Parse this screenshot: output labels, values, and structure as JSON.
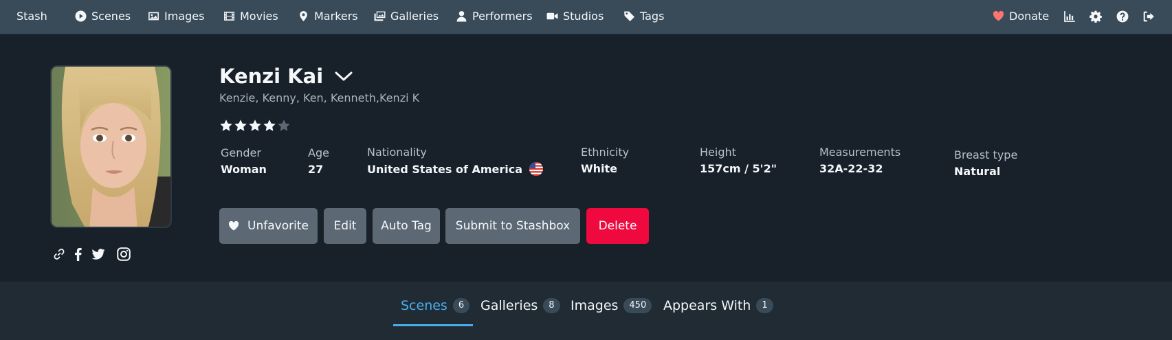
{
  "nav": {
    "brand": "Stash",
    "items": [
      {
        "label": "Scenes",
        "icon": "play-circle-icon"
      },
      {
        "label": "Images",
        "icon": "image-icon"
      },
      {
        "label": "Movies",
        "icon": "film-icon"
      },
      {
        "label": "Markers",
        "icon": "map-marker-icon"
      },
      {
        "label": "Galleries",
        "icon": "images-icon"
      },
      {
        "label": "Performers",
        "icon": "user-icon"
      },
      {
        "label": "Studios",
        "icon": "video-icon"
      },
      {
        "label": "Tags",
        "icon": "tag-icon"
      }
    ],
    "donate": "Donate",
    "right_icons": [
      "stats-icon",
      "gear-icon",
      "help-icon",
      "logout-icon"
    ]
  },
  "performer": {
    "name": "Kenzi Kai",
    "aliases": "Kenzie, Kenny, Ken, Kenneth,Kenzi K",
    "rating": 4,
    "rating_max": 5,
    "details": [
      {
        "label": "Gender",
        "value": "Woman"
      },
      {
        "label": "Age",
        "value": "27"
      },
      {
        "label": "Nationality",
        "value": "United States of America",
        "flag": "us-flag-icon"
      },
      {
        "label": "Ethnicity",
        "value": "White"
      },
      {
        "label": "Height",
        "value": "157cm / 5'2\""
      },
      {
        "label": "Measurements",
        "value": "32A-22-32"
      },
      {
        "label": "Breast type",
        "value": "Natural"
      }
    ],
    "social": [
      "link-icon",
      "facebook-icon",
      "twitter-icon",
      "instagram-icon"
    ]
  },
  "actions": {
    "unfavorite": "Unfavorite",
    "edit": "Edit",
    "auto_tag": "Auto Tag",
    "submit": "Submit to Stashbox",
    "delete": "Delete"
  },
  "tabs": [
    {
      "label": "Scenes",
      "count": "6",
      "active": true
    },
    {
      "label": "Galleries",
      "count": "8"
    },
    {
      "label": "Images",
      "count": "450"
    },
    {
      "label": "Appears With",
      "count": "1"
    }
  ],
  "colors": {
    "navbar": "#394b59",
    "background": "#182029",
    "accent": "#48aff0",
    "danger": "#f0093f",
    "button": "#5c6975",
    "heart": "#ff7373"
  }
}
